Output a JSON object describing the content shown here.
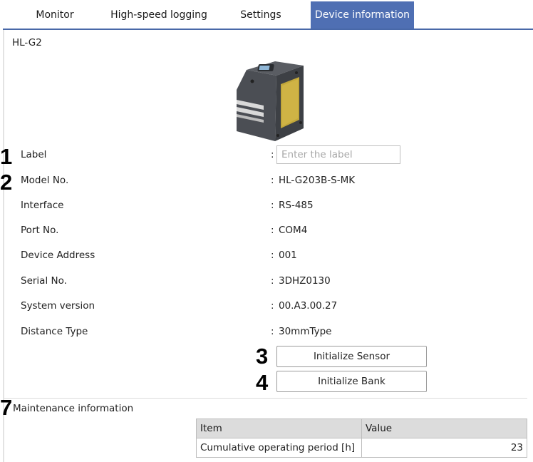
{
  "tabs": [
    {
      "label": "Monitor",
      "active": false
    },
    {
      "label": "High-speed logging",
      "active": false
    },
    {
      "label": "Settings",
      "active": false
    },
    {
      "label": "Device information",
      "active": true
    }
  ],
  "device": {
    "name": "HL-G2",
    "image_icon": "sensor-device-icon"
  },
  "info": {
    "label": {
      "label": "Label",
      "value": "",
      "placeholder": "Enter the label"
    },
    "model": {
      "label": "Model No.",
      "value": "HL-G203B-S-MK"
    },
    "interface": {
      "label": "Interface",
      "value": "RS-485"
    },
    "port": {
      "label": "Port No.",
      "value": "COM4"
    },
    "address": {
      "label": "Device Address",
      "value": "001"
    },
    "serial": {
      "label": "Serial No.",
      "value": "3DHZ0130"
    },
    "system_version": {
      "label": "System version",
      "value": "00.A3.00.27"
    },
    "distance_type": {
      "label": "Distance Type",
      "value": "30mmType"
    },
    "colon": ":"
  },
  "buttons": {
    "initialize_sensor": "Initialize Sensor",
    "initialize_bank": "Initialize Bank"
  },
  "callouts": {
    "c1": "1",
    "c2": "2",
    "c3": "3",
    "c4": "4",
    "c7": "7"
  },
  "maintenance": {
    "title": "Maintenance information",
    "headers": {
      "item": "Item",
      "value": "Value"
    },
    "rows": [
      {
        "item": "Cumulative operating period [h]",
        "value": "23"
      }
    ]
  },
  "colors": {
    "accent": "#4f6fb3",
    "tab_underline": "#4868a8",
    "table_header_bg": "#dcdcdc"
  }
}
